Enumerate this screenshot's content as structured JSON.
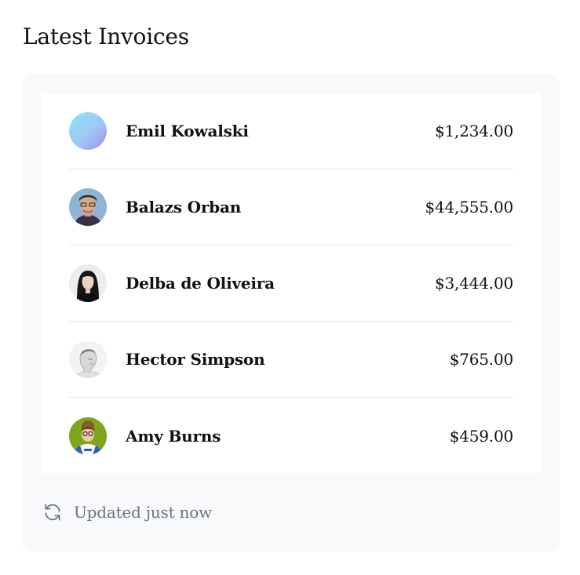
{
  "header": {
    "title": "Latest Invoices"
  },
  "invoices": [
    {
      "name": "Emil Kowalski",
      "amount": "$1,234.00",
      "avatar": "gradient-avatar"
    },
    {
      "name": "Balazs Orban",
      "amount": "$44,555.00",
      "avatar": "photo-avatar-man-glasses"
    },
    {
      "name": "Delba de Oliveira",
      "amount": "$3,444.00",
      "avatar": "photo-avatar-woman"
    },
    {
      "name": "Hector Simpson",
      "amount": "$765.00",
      "avatar": "photo-avatar-sketch-man"
    },
    {
      "name": "Amy Burns",
      "amount": "$459.00",
      "avatar": "photo-avatar-girl-glasses"
    }
  ],
  "footer": {
    "status": "Updated just now",
    "icon": "refresh-icon"
  },
  "colors": {
    "card_bg": "#f8f9fb",
    "muted_text": "#6b7280",
    "divider": "#e6e7ea"
  }
}
